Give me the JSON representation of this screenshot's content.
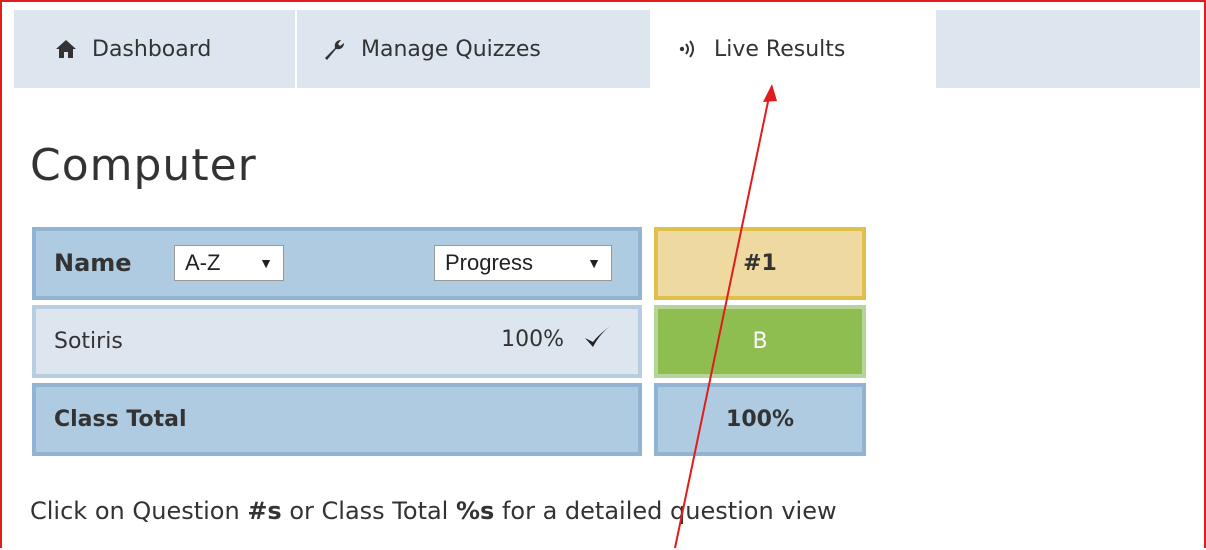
{
  "tabs": [
    {
      "label": "Dashboard",
      "icon": "home-icon"
    },
    {
      "label": "Manage Quizzes",
      "icon": "wrench-icon"
    },
    {
      "label": "Live Results",
      "icon": "signal-icon"
    }
  ],
  "active_tab": "Live Results",
  "title": "Computer",
  "table": {
    "name_header": "Name",
    "sort_select": {
      "selected": "A-Z"
    },
    "progress_select": {
      "selected": "Progress"
    },
    "question_header": "#1",
    "rows": [
      {
        "name": "Sotiris",
        "progress": "100%",
        "answer": "B"
      }
    ],
    "total_label": "Class Total",
    "total_value": "100%"
  },
  "hint": {
    "part1": "Click on Question ",
    "bold1": "#s",
    "part2": " or Class Total ",
    "bold2": "%s",
    "part3": " for a detailed question view"
  },
  "colors": {
    "tab_bar": "#dde6ef",
    "header_blue": "#aecbe1",
    "question_header": "#eed9a1",
    "correct_green": "#8ebe4f",
    "annotation_red": "#e01c1c"
  }
}
